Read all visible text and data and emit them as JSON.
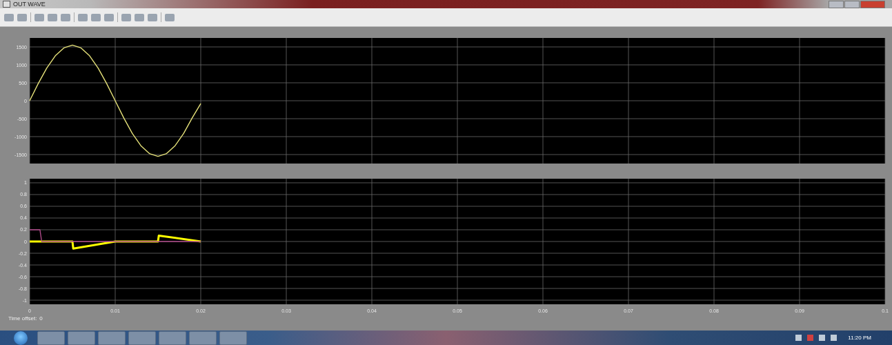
{
  "window": {
    "title": "OUT WAVE"
  },
  "plots": [
    {
      "chart_data": {
        "type": "line",
        "grid": true,
        "xlim": [
          0,
          0.1
        ],
        "ylim": [
          -1750,
          1750
        ],
        "yticks": [
          -1500,
          -1000,
          -500,
          0,
          500,
          1000,
          1500
        ],
        "x": [
          0,
          0.001,
          0.002,
          0.003,
          0.004,
          0.005,
          0.006,
          0.007,
          0.008,
          0.009,
          0.01,
          0.011,
          0.012,
          0.013,
          0.014,
          0.015,
          0.016,
          0.017,
          0.018,
          0.019,
          0.02
        ],
        "series": [
          {
            "color": "#e6e27a",
            "values": [
              0,
              479,
              911,
              1254,
              1474,
              1550,
              1474,
              1254,
              911,
              479,
              0,
              -479,
              -911,
              -1254,
              -1474,
              -1550,
              -1474,
              -1254,
              -911,
              -479,
              -80
            ]
          }
        ]
      }
    },
    {
      "chart_data": {
        "type": "line",
        "grid": true,
        "xlim": [
          0,
          0.1
        ],
        "ylim": [
          -1.07,
          1.07
        ],
        "xticks": [
          0,
          0.01,
          0.02,
          0.03,
          0.04,
          0.05,
          0.06,
          0.07,
          0.08,
          0.09,
          0.1
        ],
        "yticks": [
          -1,
          -0.8,
          -0.6,
          -0.4,
          -0.2,
          0,
          0.2,
          0.4,
          0.6,
          0.8,
          1
        ],
        "x": [
          0,
          0.0012,
          0.0014,
          0.005,
          0.0051,
          0.01,
          0.015,
          0.0151,
          0.02
        ],
        "series": [
          {
            "color": "#ffff00",
            "values": [
              0,
              0,
              0,
              0,
              -0.12,
              0,
              0,
              0.1,
              0
            ]
          },
          {
            "color": "#b04a8a",
            "values": [
              0.2,
              0.2,
              0,
              0,
              0,
              0,
              0,
              0,
              0
            ]
          }
        ]
      }
    }
  ],
  "time_offset": {
    "label": "Time offset:",
    "value": "0"
  },
  "taskbar": {
    "clock": "11:20 PM"
  }
}
